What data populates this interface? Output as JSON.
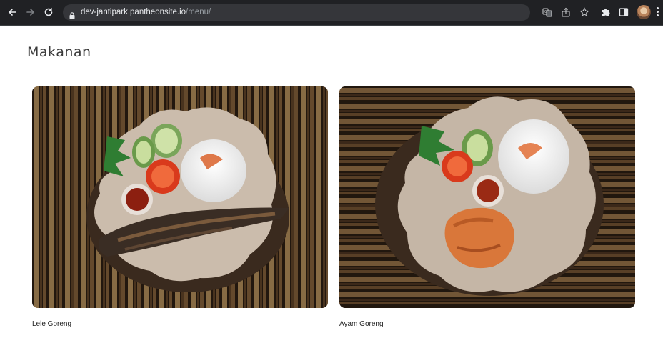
{
  "browser": {
    "url_host": "dev-jantipark.pantheonsite.io",
    "url_path": "/menu/"
  },
  "page": {
    "title": "Makanan"
  },
  "menu_items": [
    {
      "name": "Lele Goreng",
      "image": "fried-catfish-plate-photo"
    },
    {
      "name": "Ayam Goreng",
      "image": "fried-chicken-plate-photo"
    }
  ],
  "colors": {
    "chrome_bg": "#202124",
    "omnibox_bg": "#35363a",
    "page_bg": "#ffffff",
    "title_text": "#3a3a3a"
  }
}
